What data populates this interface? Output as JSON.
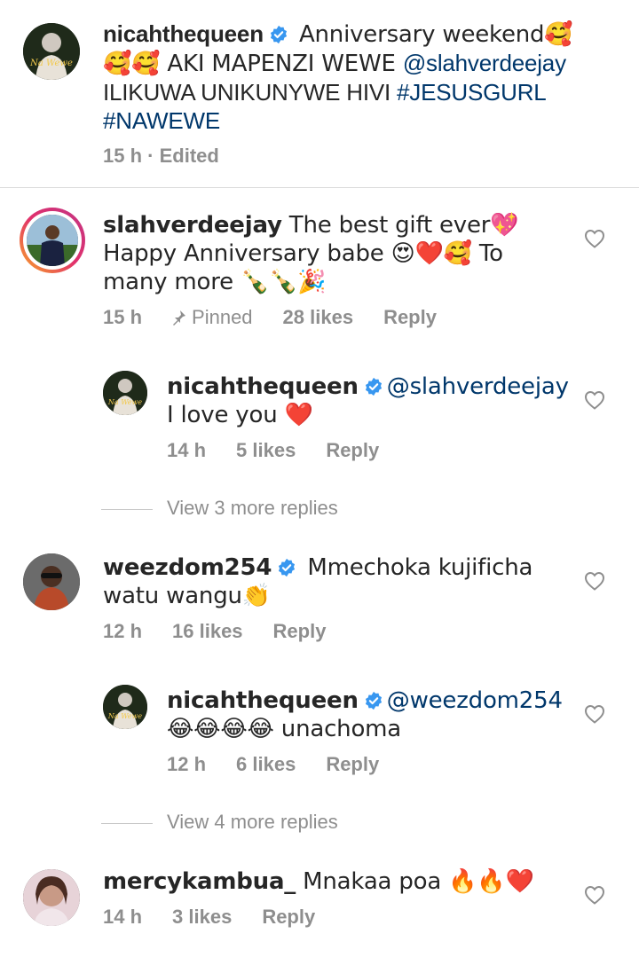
{
  "caption": {
    "username": "nicahthequeen",
    "text_a": " Anniversary weekend🥰🥰🥰 AKI MAPENZI WEWE ",
    "mention": "@slahverdeejay",
    "text_b": " ILIKUWA UNIKUNYWE HIVI ",
    "tag1": "#JESUSGURL",
    "tag2": "#NAWEWE",
    "time": "15 h",
    "dot": " · ",
    "edited": "Edited",
    "avatar_caption": "Na Wewe"
  },
  "comments": [
    {
      "username": "slahverdeejay",
      "text": " The best gift ever💖  Happy Anniversary babe 😍❤️🥰 To many more 🍾🍾🎉",
      "time": "15 h",
      "pinned": "Pinned",
      "likes": "28 likes",
      "reply": "Reply"
    },
    {
      "username": "nicahthequeen",
      "mention": "@slahverdeejay",
      "text": " I love you ❤️",
      "time": "14 h",
      "likes": "5 likes",
      "reply": "Reply",
      "avatar_caption": "Na Wewe"
    },
    {
      "view_more": "View 3 more replies"
    },
    {
      "username": "weezdom254",
      "text": " Mmechoka kujificha watu wangu👏",
      "time": "12 h",
      "likes": "16 likes",
      "reply": "Reply"
    },
    {
      "username": "nicahthequeen",
      "mention": "@weezdom254",
      "text": " 😂😂😂😂 unachoma",
      "time": "12 h",
      "likes": "6 likes",
      "reply": "Reply",
      "avatar_caption": "Na Wewe"
    },
    {
      "view_more": "View 4 more replies"
    },
    {
      "username": "mercykambua_",
      "text": " Mnakaa poa 🔥🔥❤️",
      "time": "14 h",
      "likes": "3 likes",
      "reply": "Reply"
    }
  ],
  "colors": {
    "text": "#262626",
    "meta": "#8e8e8e",
    "link": "#00376b",
    "verified": "#3897f0",
    "divider": "#dbdbdb"
  },
  "icons": [
    "verified-badge-icon",
    "heart-outline-icon",
    "pin-icon"
  ]
}
